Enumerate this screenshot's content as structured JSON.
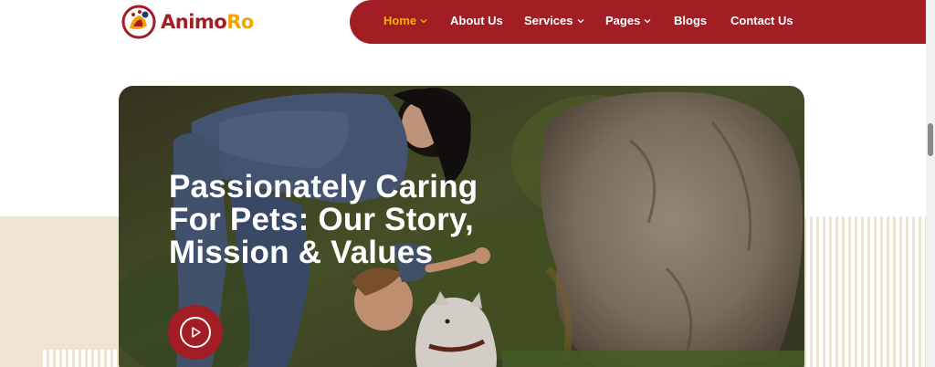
{
  "brand": {
    "part1": "Animo",
    "part2": "Ro"
  },
  "nav": {
    "items": [
      {
        "label": "Home",
        "active": true,
        "has_dropdown": true
      },
      {
        "label": "About Us",
        "active": false,
        "has_dropdown": false
      },
      {
        "label": "Services",
        "active": false,
        "has_dropdown": true
      },
      {
        "label": "Pages",
        "active": false,
        "has_dropdown": true
      },
      {
        "label": "Blogs",
        "active": false,
        "has_dropdown": false
      },
      {
        "label": "Contact Us",
        "active": false,
        "has_dropdown": false
      }
    ]
  },
  "hero": {
    "title_line1": "Passionately Caring",
    "title_line2": "For Pets: Our Story,",
    "title_line3": "Mission & Values",
    "play_icon": "play-icon"
  },
  "colors": {
    "brand_red": "#a31d24",
    "brand_yellow": "#f5a300",
    "active_nav": "#f5b300",
    "beige": "#efe3d3"
  }
}
